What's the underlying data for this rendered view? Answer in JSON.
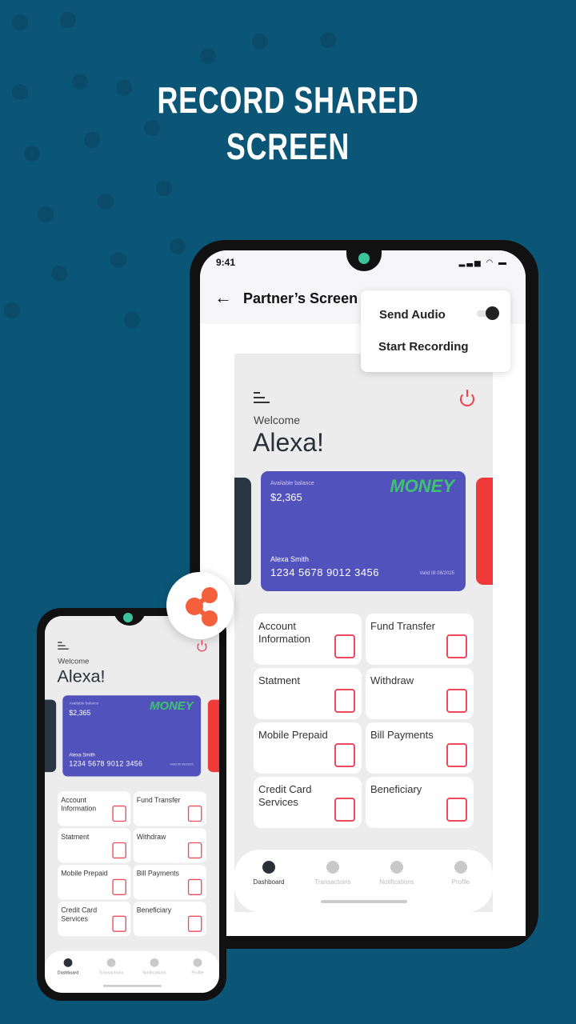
{
  "headline": {
    "line1": "RECORD SHARED",
    "line2": "SCREEN"
  },
  "status_bar": {
    "time": "9:41"
  },
  "header": {
    "title": "Partner’s Screen"
  },
  "popup": {
    "send_audio": "Send Audio",
    "send_audio_on": true,
    "start_recording": "Start Recording"
  },
  "dashboard": {
    "welcome": "Welcome",
    "name": "Alexa!",
    "card": {
      "available_label": "Available balance",
      "balance": "$2,365",
      "brand": "MONEY",
      "holder": "Alexa Smith",
      "number": "1234  5678  9012  3456",
      "valid": "Valid till 08/2025"
    },
    "tiles": [
      {
        "label": "Account Information",
        "icon": "wallet-icon"
      },
      {
        "label": "Fund Transfer",
        "icon": "currency-exchange-icon"
      },
      {
        "label": "Statment",
        "icon": "document-stack-icon"
      },
      {
        "label": "Withdraw",
        "icon": "atm-icon"
      },
      {
        "label": "Mobile Prepaid",
        "icon": "mobile-phone-icon"
      },
      {
        "label": "Bill Payments",
        "icon": "receipt-icon"
      },
      {
        "label": "Credit Card Services",
        "icon": "credit-card-icon"
      },
      {
        "label": "Beneficiary",
        "icon": "contact-book-icon"
      }
    ],
    "nav": [
      {
        "label": "Dashboard",
        "icon": "compass-icon",
        "active": true
      },
      {
        "label": "Transactoins",
        "icon": "transactions-icon",
        "active": false
      },
      {
        "label": "Notifications",
        "icon": "bell-icon",
        "active": false
      },
      {
        "label": "Profile",
        "icon": "person-icon",
        "active": false
      }
    ]
  },
  "colors": {
    "background": "#0b5677",
    "accent": "#ef4a5c",
    "card": "#5252bd",
    "brand": "#3ec46d",
    "share": "#f4603c"
  }
}
